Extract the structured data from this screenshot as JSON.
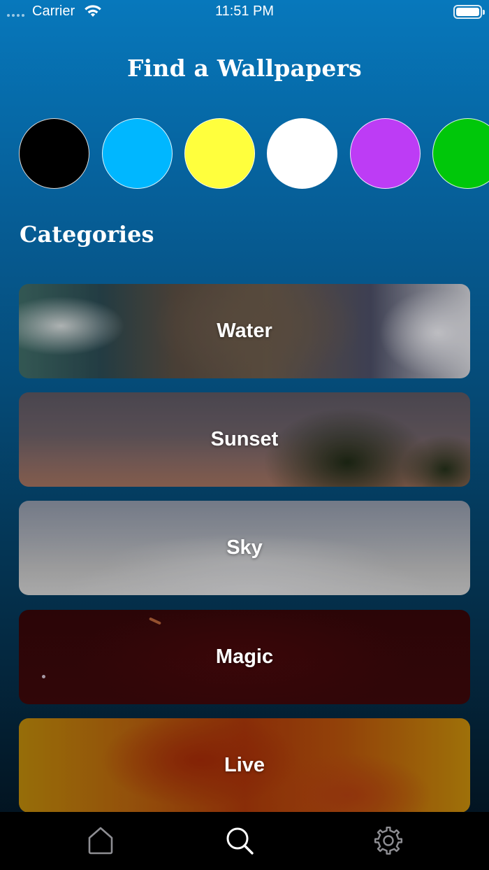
{
  "status_bar": {
    "carrier": "Carrier",
    "time": "11:51 PM"
  },
  "header": {
    "title": "Find a Wallpapers"
  },
  "colors": [
    {
      "name": "black",
      "hex": "#000000"
    },
    {
      "name": "blue",
      "hex": "#00b7ff"
    },
    {
      "name": "yellow",
      "hex": "#ffff3d"
    },
    {
      "name": "white",
      "hex": "#ffffff"
    },
    {
      "name": "purple",
      "hex": "#bd3cf5"
    },
    {
      "name": "green",
      "hex": "#00c70a"
    }
  ],
  "categories": {
    "title": "Categories",
    "items": [
      {
        "label": "Water"
      },
      {
        "label": "Sunset"
      },
      {
        "label": "Sky"
      },
      {
        "label": "Magic"
      },
      {
        "label": "Live"
      }
    ]
  },
  "tab_bar": {
    "tabs": [
      {
        "icon": "home-icon",
        "selected": false
      },
      {
        "icon": "search-icon",
        "selected": true
      },
      {
        "icon": "gear-icon",
        "selected": false
      }
    ],
    "active_color": "#ffffff",
    "inactive_color": "#8e8e93"
  }
}
